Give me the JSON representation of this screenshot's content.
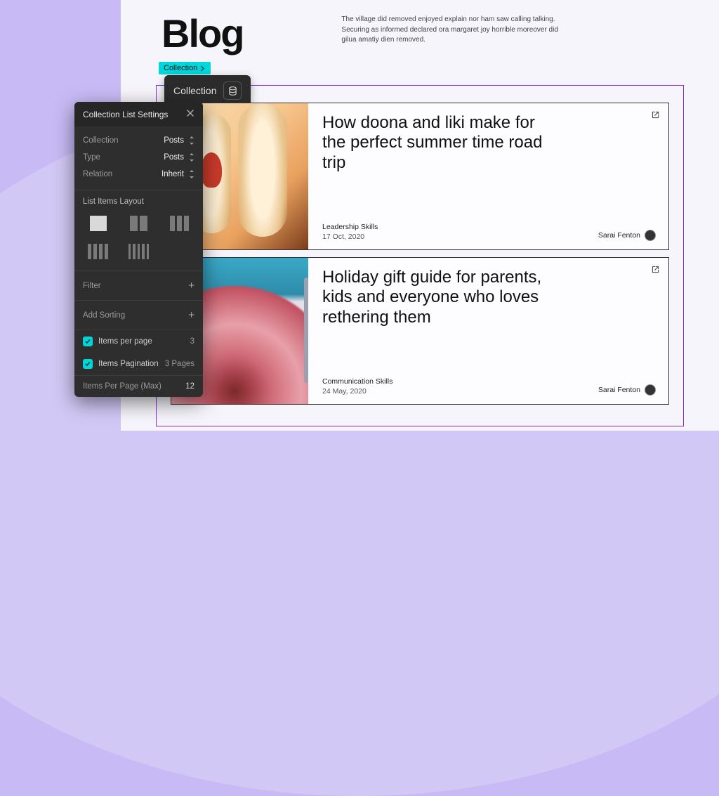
{
  "page": {
    "title": "Blog",
    "description": "The village did removed enjoyed explain nor ham saw calling talking. Securing as informed declared ora margaret joy horrible moreover did gilua amatiy dien removed."
  },
  "selection": {
    "tag_label": "Collection",
    "bar_label": "Collection"
  },
  "posts": [
    {
      "title": "How doona and liki make for the perfect summer time road trip",
      "category": "Leadership Skills",
      "date": "17 Oct, 2020",
      "author": "Sarai Fenton"
    },
    {
      "title": "Holiday gift guide for parents, kids and everyone who loves rethering them",
      "category": "Communication Skills",
      "date": "24 May, 2020",
      "author": "Sarai Fenton"
    }
  ],
  "panel": {
    "title": "Collection List Settings",
    "fields": {
      "collection": {
        "label": "Collection",
        "value": "Posts"
      },
      "type": {
        "label": "Type",
        "value": "Posts"
      },
      "relation": {
        "label": "Relation",
        "value": "Inherit"
      }
    },
    "layout_label": "List Items Layout",
    "filter_label": "Filter",
    "sorting_label": "Add Sorting",
    "items_per_page": {
      "label": "Items per page",
      "value": "3",
      "checked": true
    },
    "items_pagination": {
      "label": "Items Pagination",
      "value": "3 Pages",
      "checked": true
    },
    "items_max": {
      "label": "Items Per Page (Max)",
      "value": "12"
    }
  },
  "colors": {
    "accent": "#00d7db",
    "outline": "#8a2be2"
  }
}
